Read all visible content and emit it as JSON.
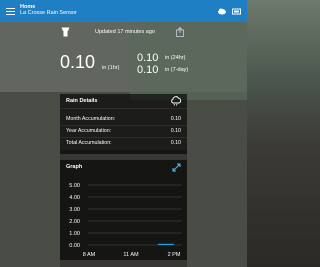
{
  "header": {
    "title": "Home",
    "subtitle": "La Crosse Rain Sensor",
    "icons": [
      "menu-icon",
      "cloud-icon",
      "wide-view-icon"
    ]
  },
  "status": {
    "updated": "Updated 17 minutes ago"
  },
  "readings": {
    "today_value": "0.10",
    "today_unit": "in (1hr)",
    "r24_value": "0.10",
    "r24_unit": "in (24hr)",
    "r7_value": "0.10",
    "r7_unit": "in (7-day)"
  },
  "rain_details": {
    "title": "Rain Details",
    "rows": [
      {
        "label": "Month Accumulation:",
        "value": "0.10"
      },
      {
        "label": "Year Accumulation:",
        "value": "0.10"
      },
      {
        "label": "Total Accumulation:",
        "value": "0.10"
      }
    ]
  },
  "graph": {
    "title": "Graph"
  },
  "chart_data": {
    "type": "bar",
    "title": "",
    "xlabel": "",
    "ylabel": "",
    "ylim": [
      0,
      5
    ],
    "yticks": [
      "5.00",
      "4.00",
      "3.00",
      "2.00",
      "1.00",
      "0.00"
    ],
    "xticks": [
      "8 AM",
      "11 AM",
      "2 PM"
    ],
    "bar_color": "#1f9fe0",
    "values": [
      {
        "x": "2 PM",
        "y": 0.1
      }
    ]
  },
  "colors": {
    "appbar": "#1f7fc4",
    "bar": "#1f9fe0"
  }
}
